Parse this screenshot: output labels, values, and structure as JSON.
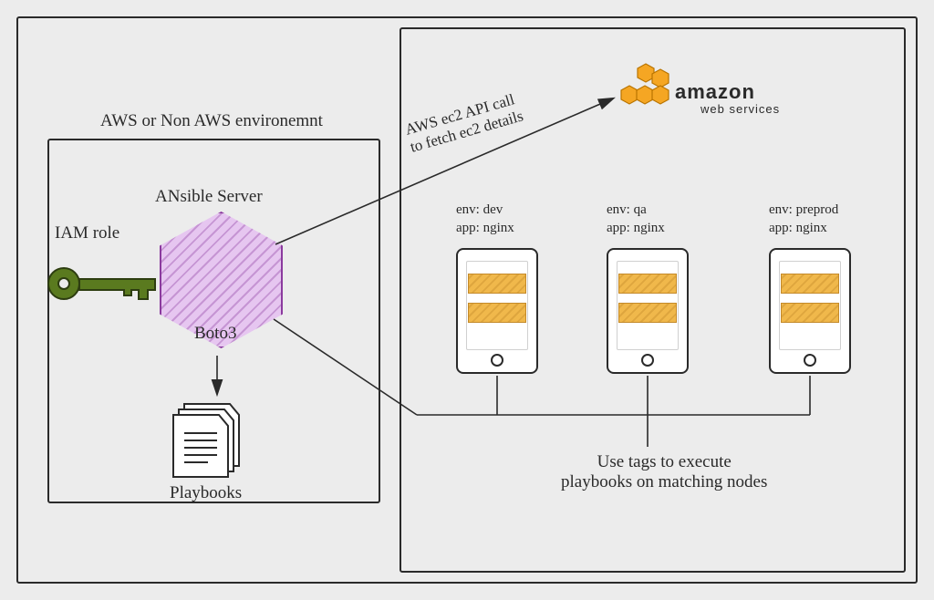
{
  "diagram": {
    "left_caption": "AWS or Non AWS environemnt",
    "components": {
      "ansible_server": "ANsible Server",
      "boto3": "Boto3",
      "iam_role": "IAM role",
      "playbooks": "Playbooks"
    },
    "arrow_api": "AWS ec2 API call\nto fetch ec2 details",
    "aws": {
      "brand": "amazon",
      "subline": "web services"
    },
    "instances": [
      {
        "env": "env: dev",
        "app": "app: nginx"
      },
      {
        "env": "env: qa",
        "app": "app: nginx"
      },
      {
        "env": "env: preprod",
        "app": "app: nginx"
      }
    ],
    "tags_caption": "Use tags to execute\nplaybooks on matching nodes"
  }
}
